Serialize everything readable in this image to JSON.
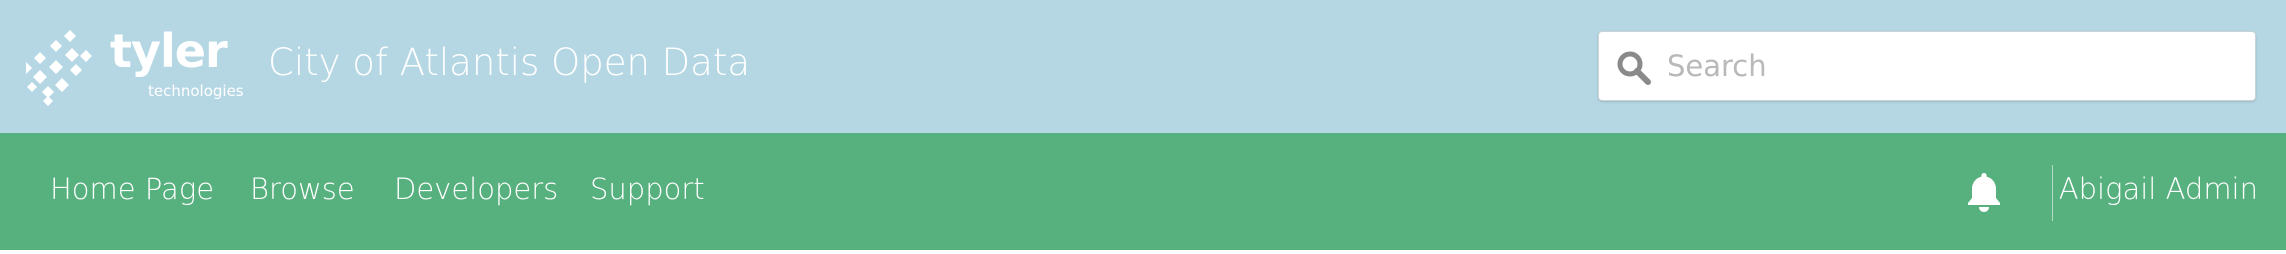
{
  "header": {
    "logo": {
      "name": "tyler",
      "subtext": "technologies",
      "icon": "tyler-dots-logo-icon"
    },
    "site_title": "City of Atlantis Open Data",
    "search": {
      "placeholder": "Search",
      "value": "",
      "icon": "search-icon"
    }
  },
  "nav": {
    "items": [
      {
        "label": "Home Page"
      },
      {
        "label": "Browse"
      },
      {
        "label": "Developers"
      },
      {
        "label": "Support"
      }
    ],
    "notifications_icon": "bell-icon",
    "user_name": "Abigail Admin"
  },
  "colors": {
    "header_bg": "#b5d7e4",
    "nav_bg": "#57b17e",
    "text_light": "#ffffff",
    "search_placeholder": "#b9b9b9",
    "search_icon": "#8a8a8a"
  }
}
